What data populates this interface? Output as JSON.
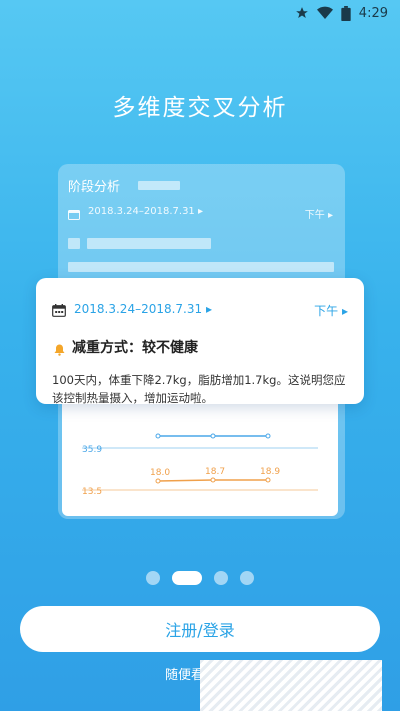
{
  "status_bar": {
    "time": "4:29"
  },
  "hero": {
    "title": "多维度交叉分析"
  },
  "background_card": {
    "title": "阶段分析",
    "date_range": "2018.3.24–2018.7.31",
    "period": "下午",
    "chart": {
      "y_labels": [
        "35.9",
        "13.5"
      ],
      "point_labels": [
        "18.0",
        "18.7",
        "18.9"
      ],
      "colors": {
        "upper_line": "#4aa7e8",
        "lower_line": "#f0a04b"
      }
    }
  },
  "front_card": {
    "date_range": "2018.3.24–2018.7.31",
    "period": "下午",
    "heading": "减重方式：较不健康",
    "description": "100天内，体重下降2.7kg，脂肪增加1.7kg。这说明您应该控制热量摄入，增加运动啦。"
  },
  "pager": {
    "count": 4,
    "active_index": 1
  },
  "actions": {
    "login_label": "注册/登录",
    "browse_label": "随便看"
  },
  "colors": {
    "accent": "#2aa3e6",
    "bg_top": "#56c8f3",
    "bg_bottom": "#2f9fe6"
  }
}
